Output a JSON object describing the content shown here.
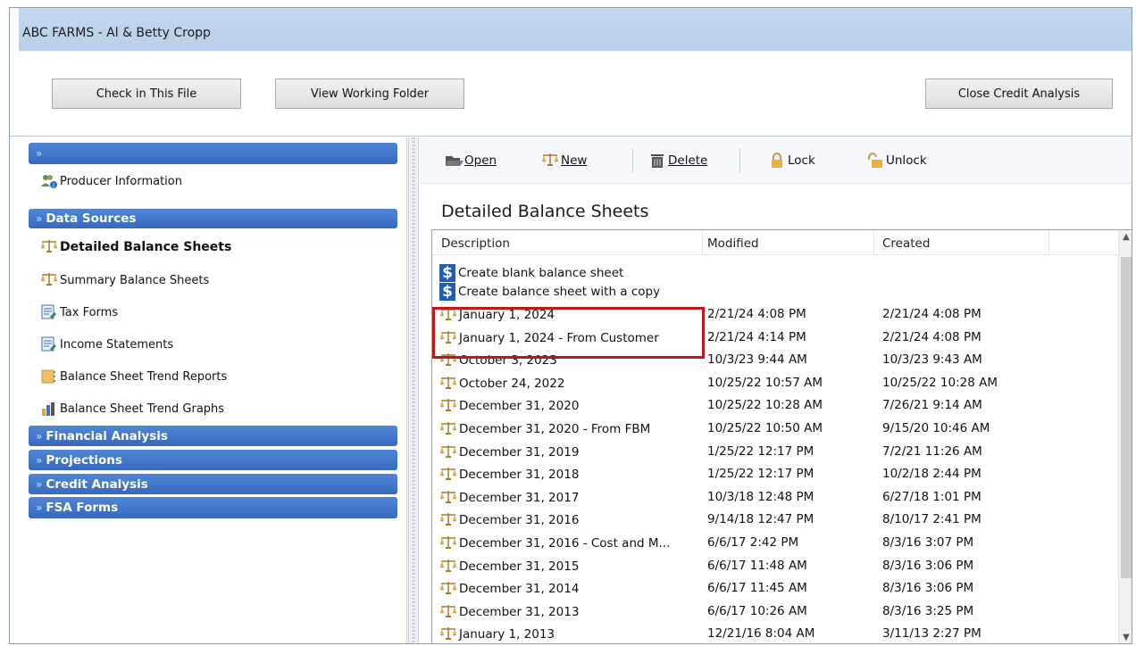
{
  "window": {
    "title": "ABC FARMS - Al & Betty Cropp"
  },
  "top_buttons": {
    "check_in": "Check in This File",
    "view_working_folder": "View Working Folder",
    "close_credit_analysis": "Close Credit Analysis"
  },
  "sidebar": {
    "producer_information": "Producer Information",
    "sections": {
      "data_sources": "Data Sources",
      "financial_analysis": "Financial Analysis",
      "projections": "Projections",
      "credit_analysis": "Credit Analysis",
      "fsa_forms": "FSA Forms"
    },
    "items": [
      {
        "label": "Detailed Balance Sheets",
        "icon": "scale-icon",
        "active": true
      },
      {
        "label": "Summary Balance Sheets",
        "icon": "scale-icon"
      },
      {
        "label": "Tax Forms",
        "icon": "tax-form-icon"
      },
      {
        "label": "Income Statements",
        "icon": "income-statement-icon"
      },
      {
        "label": "Balance Sheet Trend Reports",
        "icon": "trend-report-icon"
      },
      {
        "label": "Balance Sheet Trend Graphs",
        "icon": "trend-graph-icon"
      }
    ]
  },
  "toolbar": {
    "open": "Open",
    "new": "New",
    "delete": "Delete",
    "lock": "Lock",
    "unlock": "Unlock"
  },
  "content": {
    "title": "Detailed Balance Sheets",
    "columns": {
      "description": "Description",
      "modified": "Modified",
      "created": "Created"
    },
    "actions": [
      {
        "label": "Create blank balance sheet",
        "icon": "dollar-icon"
      },
      {
        "label": "Create balance sheet with a copy",
        "icon": "dollar-icon"
      }
    ],
    "rows": [
      {
        "description": "January 1, 2024",
        "modified": "2/21/24 4:08 PM",
        "created": "2/21/24 4:08 PM"
      },
      {
        "description": "January 1, 2024 - From Customer",
        "modified": "2/21/24 4:14 PM",
        "created": "2/21/24 4:08 PM"
      },
      {
        "description": "October 3, 2023",
        "modified": "10/3/23 9:44 AM",
        "created": "10/3/23 9:43 AM"
      },
      {
        "description": "October 24, 2022",
        "modified": "10/25/22 10:57 AM",
        "created": "10/25/22 10:28 AM"
      },
      {
        "description": "December 31, 2020",
        "modified": "10/25/22 10:28 AM",
        "created": "7/26/21 9:14 AM"
      },
      {
        "description": "December 31, 2020 - From FBM",
        "modified": "10/25/22 10:50 AM",
        "created": "9/15/20 10:46 AM"
      },
      {
        "description": "December 31, 2019",
        "modified": "1/25/22 12:17 PM",
        "created": "7/2/21 11:26 AM"
      },
      {
        "description": "December 31, 2018",
        "modified": "1/25/22 12:17 PM",
        "created": "10/2/18 2:44 PM"
      },
      {
        "description": "December 31, 2017",
        "modified": "10/3/18 12:48 PM",
        "created": "6/27/18 1:01 PM"
      },
      {
        "description": "December 31, 2016",
        "modified": "9/14/18 12:47 PM",
        "created": "8/10/17 2:41 PM"
      },
      {
        "description": "December 31, 2016 - Cost and M...",
        "modified": "6/6/17 2:42 PM",
        "created": "8/3/16 3:07 PM"
      },
      {
        "description": "December 31, 2015",
        "modified": "6/6/17 11:48 AM",
        "created": "8/3/16 3:06 PM"
      },
      {
        "description": "December 31, 2014",
        "modified": "6/6/17 11:45 AM",
        "created": "8/3/16 3:06 PM"
      },
      {
        "description": "December 31, 2013",
        "modified": "6/6/17 10:26 AM",
        "created": "8/3/16 3:25 PM"
      },
      {
        "description": "January 1, 2013",
        "modified": "12/21/16 8:04 AM",
        "created": "3/11/13 2:27 PM"
      }
    ]
  },
  "colors": {
    "accent": "#3b6fc4",
    "highlight": "#c2171a",
    "scale_icon": "#c89a3c"
  }
}
